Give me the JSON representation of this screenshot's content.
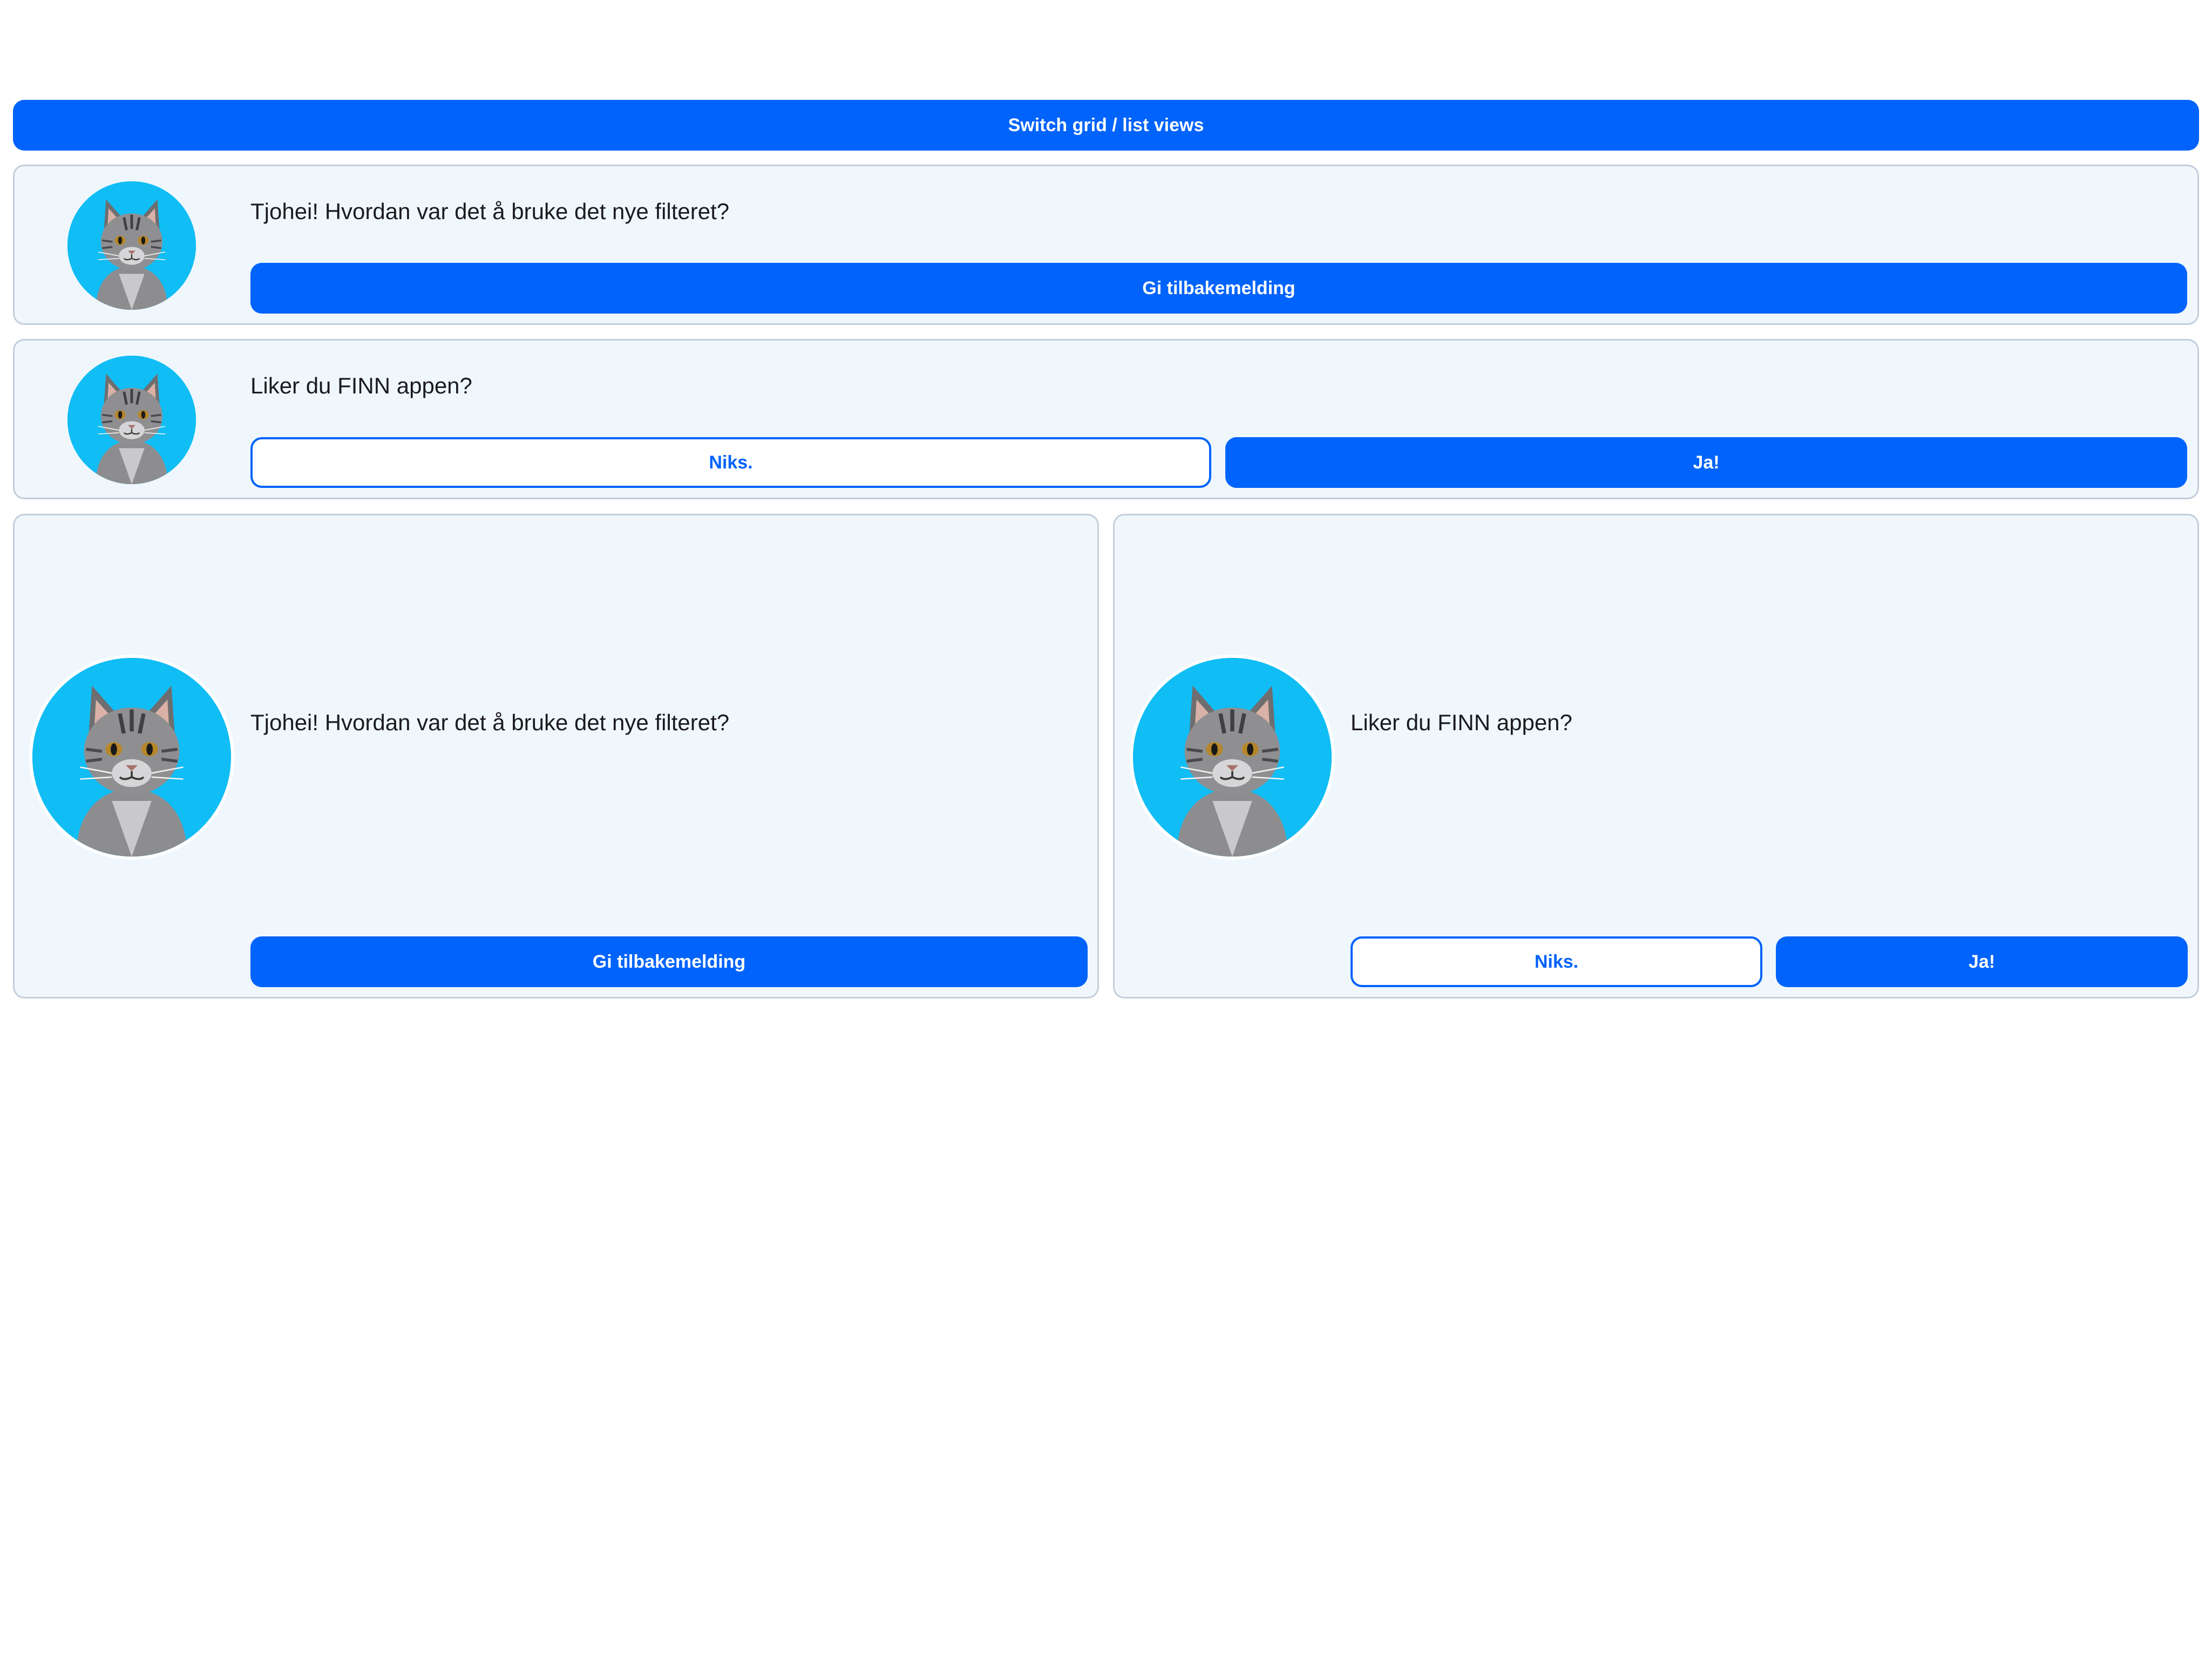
{
  "toolbar": {
    "switch_label": "Switch grid / list views"
  },
  "list_view": {
    "feedback_card": {
      "message": "Tjohei! Hvordan var det å bruke det nye filteret?",
      "button_label": "Gi tilbakemelding"
    },
    "question_card": {
      "message": "Liker du FINN appen?",
      "no_label": "Niks.",
      "yes_label": "Ja!"
    }
  },
  "grid_view": {
    "feedback_card": {
      "message": "Tjohei! Hvordan var det å bruke det nye filteret?",
      "button_label": "Gi tilbakemelding"
    },
    "question_card": {
      "message": "Liker du FINN appen?",
      "no_label": "Niks.",
      "yes_label": "Ja!"
    }
  },
  "avatar": {
    "icon": "cat-avatar-icon",
    "background": "#10bdf5"
  },
  "colors": {
    "primary": "#0063fb",
    "card_background": "#eff7fd",
    "card_border": "#c3cedc"
  }
}
